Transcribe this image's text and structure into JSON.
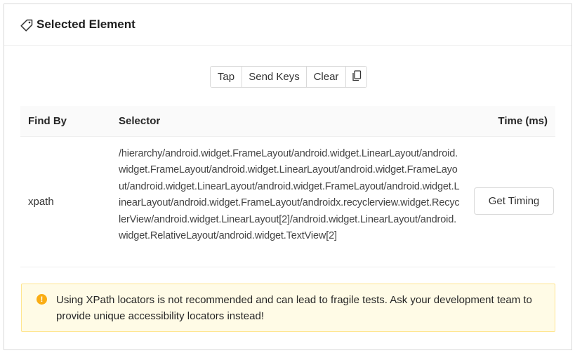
{
  "header": {
    "icon": "tag-icon",
    "title": "Selected Element"
  },
  "toolbar": {
    "tap_label": "Tap",
    "send_keys_label": "Send Keys",
    "clear_label": "Clear",
    "copy_icon": "copy-icon"
  },
  "table": {
    "columns": [
      "Find By",
      "Selector",
      "Time (ms)"
    ],
    "rows": [
      {
        "find_by": "xpath",
        "selector": "/hierarchy/android.widget.FrameLayout/android.widget.LinearLayout/android.widget.FrameLayout/android.widget.LinearLayout/android.widget.FrameLayout/android.widget.LinearLayout/android.widget.FrameLayout/android.widget.LinearLayout/android.widget.FrameLayout/androidx.recyclerview.widget.RecyclerView/android.widget.LinearLayout[2]/android.widget.LinearLayout/android.widget.RelativeLayout/android.widget.TextView[2]",
        "action_label": "Get Timing"
      }
    ]
  },
  "alert": {
    "icon": "warning-icon",
    "color": "#faad14",
    "message": "Using XPath locators is not recommended and can lead to fragile tests. Ask your development team to provide unique accessibility locators instead!"
  }
}
